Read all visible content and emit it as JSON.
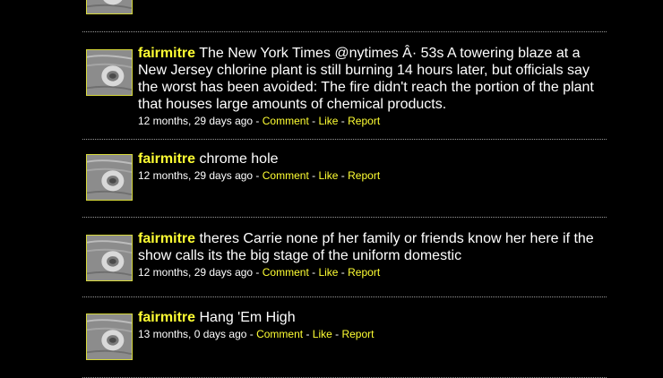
{
  "posts": [
    {
      "username": "fairmitre",
      "text": "The New York Times @nytimes Â· 53s A towering blaze at a New Jersey chlorine plant is still burning 14 hours later, but officials say the worst has been avoided: The fire didn't reach the portion of the plant that houses large amounts of chemical products.",
      "timestamp": "12 months, 29 days ago",
      "actions": {
        "comment": "Comment",
        "like": "Like",
        "report": "Report"
      }
    },
    {
      "username": "fairmitre",
      "text": "chrome hole",
      "timestamp": "12 months, 29 days ago",
      "actions": {
        "comment": "Comment",
        "like": "Like",
        "report": "Report"
      }
    },
    {
      "username": "fairmitre",
      "text": "theres Carrie none pf her family or friends know her here if the show calls its the big stage of the uniform domestic",
      "timestamp": "12 months, 29 days ago",
      "actions": {
        "comment": "Comment",
        "like": "Like",
        "report": "Report"
      }
    },
    {
      "username": "fairmitre",
      "text": "Hang 'Em High",
      "timestamp": "13 months, 0 days ago",
      "actions": {
        "comment": "Comment",
        "like": "Like",
        "report": "Report"
      }
    }
  ],
  "separator": " - ",
  "icons": {
    "avatar": "user-avatar-photo"
  },
  "colors": {
    "background": "#000000",
    "username": "#ffff33",
    "link": "#ffff33",
    "divider": "#9a9a9a"
  }
}
